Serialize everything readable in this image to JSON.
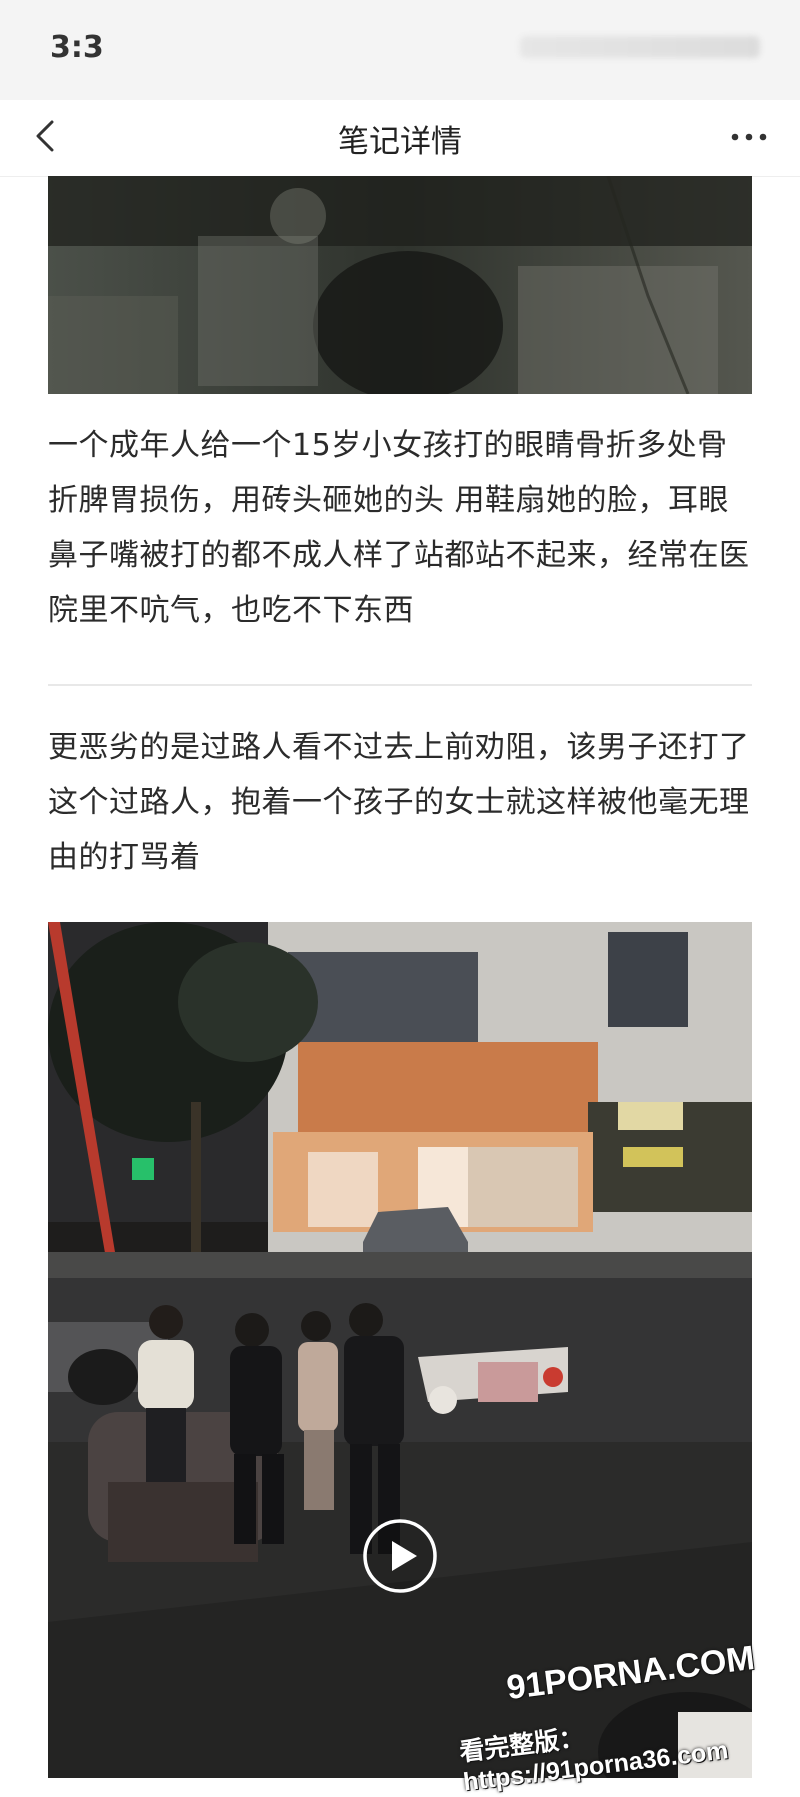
{
  "status_bar": {
    "time": "3:3"
  },
  "nav": {
    "title": "笔记详情",
    "back_icon": "chevron-left-icon",
    "more_icon": "more-horizontal-icon"
  },
  "post": {
    "paragraph1": "一个成年人给一个15岁小女孩打的眼睛骨折多处骨折脾胃损伤，用砖头砸她的头 用鞋扇她的脸，耳眼鼻子嘴被打的都不成人样了站都站不起来，经常在医院里不吭气，也吃不下东西",
    "paragraph2": "更恶劣的是过路人看不过去上前劝阻，该男子还打了这个过路人，抱着一个孩子的女士就这样被他毫无理由的打骂着"
  },
  "video": {
    "play_icon": "play-icon"
  },
  "watermark": {
    "line1": "91PORNA.COM",
    "line2": "看完整版：https://91porna36.com"
  },
  "colors": {
    "background": "#ffffff",
    "text": "#2b2b2b",
    "divider": "#e8e8e8",
    "status_bar": "#f4f4f4"
  }
}
